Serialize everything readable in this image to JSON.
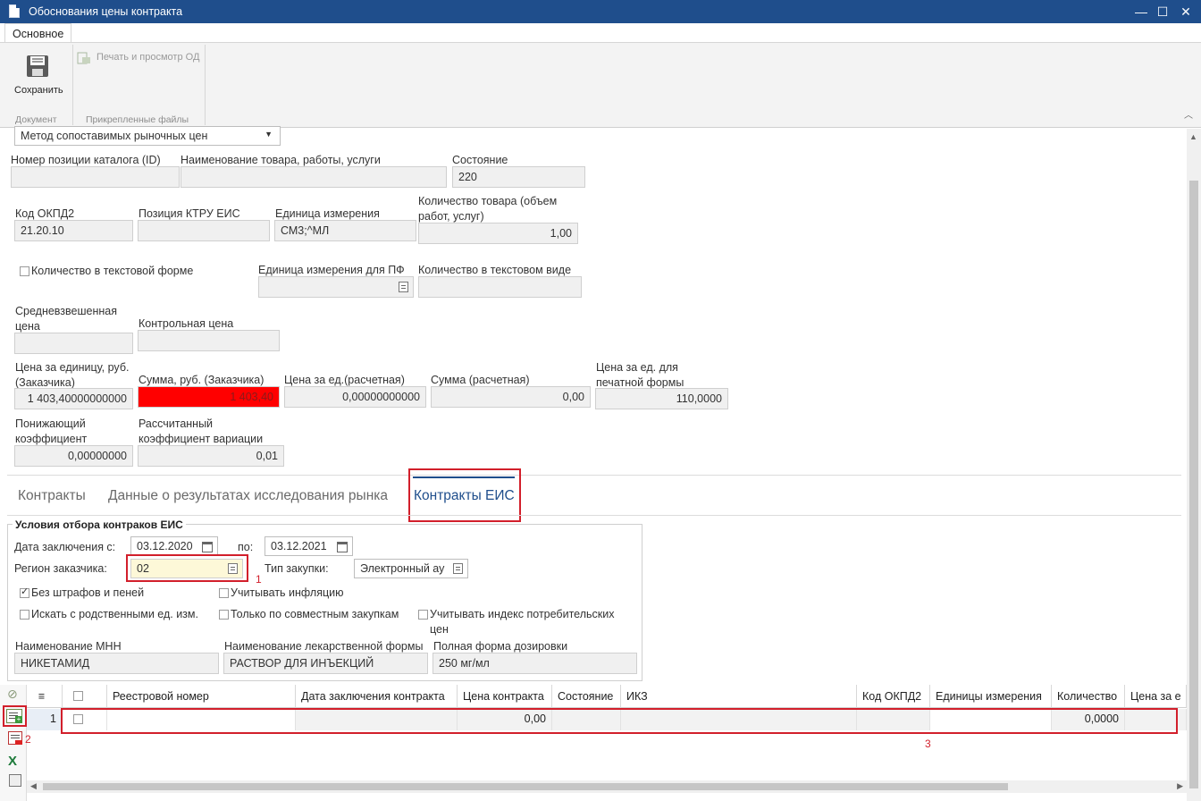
{
  "window": {
    "title": "Обоснования цены контракта",
    "minimize": "—",
    "maximize": "☐",
    "close": "✕"
  },
  "ribbon": {
    "tab": "Основное",
    "save_label": "Сохранить",
    "print_label": "Печать и просмотр ОД",
    "group_document": "Документ",
    "group_files": "Прикрепленные файлы"
  },
  "form": {
    "method_select": "Метод сопоставимых рыночных цен",
    "catalog_id_label": "Номер позиции каталога (ID)",
    "catalog_id": "",
    "product_name_label": "Наименование товара, работы, услуги",
    "product_name": "",
    "state_label": "Состояние",
    "state": "220",
    "okpd2_label": "Код ОКПД2",
    "okpd2": "21.20.10",
    "ktru_label": "Позиция КТРУ ЕИС",
    "ktru": "",
    "unit_label": "Единица измерения",
    "unit": "СМ3;^МЛ",
    "qty_label_1": "Количество товара (объем",
    "qty_label_2": "работ, услуг)",
    "qty": "1,00",
    "qty_text_check_label": "Количество в текстовой форме",
    "unit_pf_label": "Единица измерения для ПФ",
    "unit_pf": "",
    "qty_text_label": "Количество в текстовом виде",
    "qty_text": "",
    "avg_price_label_1": "Средневзвешенная",
    "avg_price_label_2": "цена",
    "avg_price": "",
    "control_price_label": "Контрольная цена",
    "control_price": "",
    "unit_price_label_1": "Цена за единицу, руб.",
    "unit_price_label_2": "(Заказчика)",
    "unit_price": "1 403,40000000000",
    "sum_label": "Сумма, руб. (Заказчика)",
    "sum": "1 403,40",
    "calc_price_label": "Цена за ед.(расчетная)",
    "calc_price": "0,00000000000",
    "calc_sum_label": "Сумма (расчетная)",
    "calc_sum": "0,00",
    "print_price_label_1": "Цена за ед. для",
    "print_price_label_2": "печатной формы",
    "print_price": "110,0000",
    "reduce_coef_label_1": "Понижающий",
    "reduce_coef_label_2": "коэффициент",
    "reduce_coef": "0,00000000",
    "variation_label_1": "Рассчитанный",
    "variation_label_2": "коэффициент вариации",
    "variation": "0,01"
  },
  "tabs": [
    "Контракты",
    "Данные о результатах исследования рынка",
    "Контракты ЕИС"
  ],
  "filters": {
    "group_title": "Условия отбора контраков ЕИС",
    "date_from_label": "Дата заключения с:",
    "date_from": "03.12.2020",
    "date_to_label": "по:",
    "date_to": "03.12.2021",
    "region_label": "Регион заказчика:",
    "region": "02",
    "purchase_type_label": "Тип закупки:",
    "purchase_type": "Электронный ау",
    "no_penalties": "Без штрафов и пеней",
    "inflation": "Учитывать инфляцию",
    "related_units": "Искать с родственными ед. изм.",
    "joint_only": "Только по совместным закупкам",
    "cpi_1": "Учитывать индекс потребительских",
    "cpi_2": "цен",
    "mnn_label": "Наименование МНН",
    "mnn": "НИКЕТАМИД",
    "dosage_form_label": "Наименование лекарственной формы",
    "dosage_form": "РАСТВОР ДЛЯ ИНЪЕКЦИЙ",
    "dosage_full_label": "Полная форма дозировки",
    "dosage_full": "250 мг/мл"
  },
  "grid": {
    "columns": [
      "Реестровой номер",
      "Дата заключения контракта",
      "Цена контракта",
      "Состояние",
      "ИКЗ",
      "Код ОКПД2",
      "Единицы измерения",
      "Количество",
      "Цена за е"
    ],
    "row": {
      "num": "1",
      "price": "0,00",
      "qty": "0,0000"
    }
  },
  "annotations": {
    "a1": "1",
    "a2": "2",
    "a3": "3"
  },
  "colors": {
    "title_bar": "#1f4e8c",
    "highlight_red": "#ff0000",
    "annotation": "#d21f2b"
  }
}
